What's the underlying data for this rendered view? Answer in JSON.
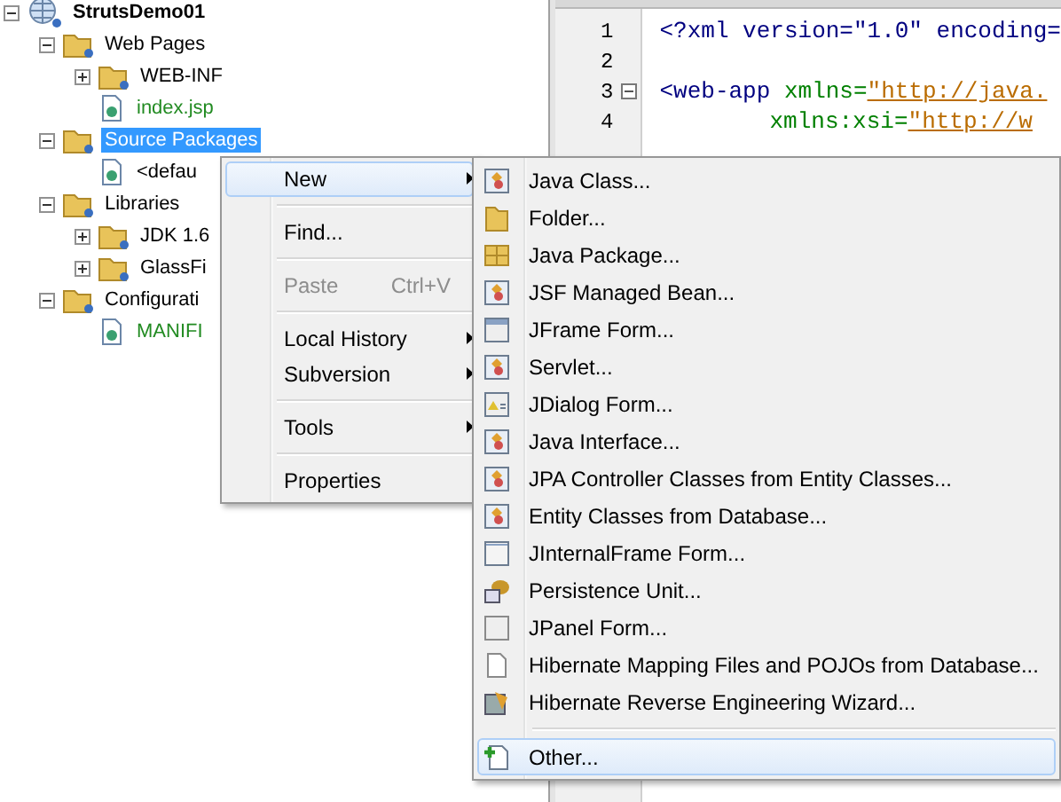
{
  "project_tree": {
    "label": "StrutsDemo01",
    "expanded": true,
    "selected": false,
    "children": [
      {
        "label": "Web Pages",
        "expanded": true,
        "selected": false,
        "children": [
          {
            "label": "WEB-INF",
            "expanded": false,
            "selected": false
          },
          {
            "label": "index.jsp",
            "selected": false,
            "color": "#228b22"
          }
        ]
      },
      {
        "label": "Source Packages",
        "expanded": true,
        "selected": true,
        "children": [
          {
            "label": "<defau",
            "selected": false
          }
        ]
      },
      {
        "label": "Libraries",
        "expanded": true,
        "selected": false,
        "children": [
          {
            "label": "JDK 1.6",
            "expanded": false,
            "selected": false
          },
          {
            "label": "GlassFi",
            "expanded": false,
            "selected": false
          }
        ]
      },
      {
        "label": "Configurati",
        "expanded": true,
        "selected": false,
        "children": [
          {
            "label": "MANIFI",
            "selected": false,
            "color": "#228b22"
          }
        ]
      }
    ]
  },
  "editor": {
    "lines": [
      {
        "number": "1",
        "fold": false,
        "tokens": [
          {
            "kind": "tag",
            "text": "<?xml version=\"1.0\" encoding="
          }
        ]
      },
      {
        "number": "2",
        "fold": false
      },
      {
        "number": "3",
        "fold": true,
        "tokens": [
          {
            "kind": "tag",
            "text": "<web-app "
          },
          {
            "kind": "attr",
            "text": "xmlns="
          },
          {
            "kind": "string",
            "text": "\"http://java."
          }
        ]
      },
      {
        "number": "4",
        "fold": false,
        "indent": true,
        "tokens": [
          {
            "kind": "attr",
            "text": "xmlns:xsi="
          },
          {
            "kind": "string",
            "text": "\"http://w"
          }
        ]
      }
    ]
  },
  "context_menu": {
    "groups": [
      [
        {
          "label": "New",
          "selected": true,
          "disabled": false,
          "submenu": true
        }
      ],
      [
        {
          "label": "Find...",
          "selected": false,
          "disabled": false,
          "submenu": false
        }
      ],
      [
        {
          "label": "Paste",
          "shortcut": "Ctrl+V",
          "selected": false,
          "disabled": true,
          "submenu": false
        }
      ],
      [
        {
          "label": "Local History",
          "selected": false,
          "disabled": false,
          "submenu": true
        },
        {
          "label": "Subversion",
          "selected": false,
          "disabled": false,
          "submenu": true
        }
      ],
      [
        {
          "label": "Tools",
          "selected": false,
          "disabled": false,
          "submenu": true
        }
      ],
      [
        {
          "label": "Properties",
          "selected": false,
          "disabled": false,
          "submenu": false
        }
      ]
    ]
  },
  "new_submenu": {
    "groups": [
      [
        {
          "label": "Java Class...",
          "selected": false
        },
        {
          "label": "Folder...",
          "selected": false
        },
        {
          "label": "Java Package...",
          "selected": false
        },
        {
          "label": "JSF Managed Bean...",
          "selected": false
        },
        {
          "label": "JFrame Form...",
          "selected": false
        },
        {
          "label": "Servlet...",
          "selected": false
        },
        {
          "label": "JDialog Form...",
          "selected": false
        },
        {
          "label": "Java Interface...",
          "selected": false
        },
        {
          "label": "JPA Controller Classes from Entity Classes...",
          "selected": false
        },
        {
          "label": "Entity Classes from Database...",
          "selected": false
        },
        {
          "label": "JInternalFrame Form...",
          "selected": false
        },
        {
          "label": "Persistence Unit...",
          "selected": false
        },
        {
          "label": "JPanel Form...",
          "selected": false
        },
        {
          "label": "Hibernate Mapping Files and POJOs from Database...",
          "selected": false
        },
        {
          "label": "Hibernate Reverse Engineering Wizard...",
          "selected": false
        }
      ],
      [
        {
          "label": "Other...",
          "selected": true
        }
      ]
    ]
  }
}
